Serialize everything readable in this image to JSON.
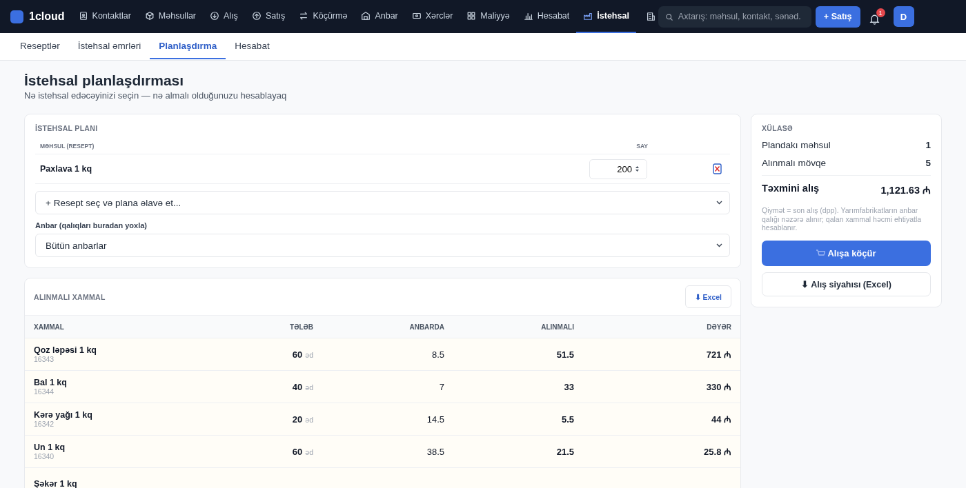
{
  "topbar": {
    "logo": "1cloud",
    "nav": [
      {
        "label": "Kontaktlar",
        "selected": false
      },
      {
        "label": "Məhsullar",
        "selected": false
      },
      {
        "label": "Alış",
        "selected": false
      },
      {
        "label": "Satış",
        "selected": false
      },
      {
        "label": "Köçürmə",
        "selected": false
      },
      {
        "label": "Anbar",
        "selected": false
      },
      {
        "label": "Xərclər",
        "selected": false
      },
      {
        "label": "Maliyyə",
        "selected": false
      },
      {
        "label": "Hesabat",
        "selected": false
      },
      {
        "label": "İstehsal",
        "selected": true
      }
    ],
    "search": {
      "placeholder": "Axtarış: məhsul, kontakt, sənəd."
    },
    "new_sale_button": "+ Satış",
    "notifications": "1",
    "avatar": "D"
  },
  "subtabs": [
    {
      "label": "Reseptlər",
      "selected": false
    },
    {
      "label": "İstehsal əmrləri",
      "selected": false
    },
    {
      "label": "Planlaşdırma",
      "selected": true
    },
    {
      "label": "Hesabat",
      "selected": false
    }
  ],
  "page": {
    "title": "İstehsal planlaşdırması",
    "subtitle": "Nə istehsal edəcəyinizi seçin — nə almalı olduğunuzu hesablayaq"
  },
  "plan": {
    "title": "İSTEHSAL PLANI",
    "columns": [
      "MƏHSUL (RESEPT)",
      "SAY"
    ],
    "rows": [
      {
        "product": "Paxlava 1 kq",
        "quantity": "200"
      }
    ],
    "add_select": "+ Resept seç və plana əlavə et...",
    "warehouse_label": "Anbar (qalıqları buradan yoxla)",
    "warehouse_select": "Bütün anbarlar"
  },
  "summary": {
    "title": "XÜLASƏ",
    "rows": [
      {
        "label": "Plandakı məhsul",
        "value": "1"
      },
      {
        "label": "Alınmalı mövqe",
        "value": "5"
      }
    ],
    "total_label": "Təxmini alış",
    "total_value": "1,121.63 ₼",
    "note": "Qiymət = son alış (dpp). Yarımfabrikatların anbar qalığı nəzərə alınır; qalan xammal həcmi ehtiyatla hesablanır.",
    "primary_button": "Alışa köçür",
    "excel_button": "⬇ Alış siyahısı (Excel)"
  },
  "materials": {
    "title": "ALINMALI XAMMAL",
    "excel_button": "⬇ Excel",
    "columns": [
      "XAMMAL",
      "TƏLƏB",
      "ANBARDA",
      "ALINMALI",
      "DƏYƏR"
    ],
    "rows": [
      {
        "name": "Qoz ləpəsi 1 kq",
        "code": "16343",
        "need": "60",
        "unit": "əd",
        "stock": "8.5",
        "to_buy": "51.5",
        "value": "721 ₼"
      },
      {
        "name": "Bal 1 kq",
        "code": "16344",
        "need": "40",
        "unit": "əd",
        "stock": "7",
        "to_buy": "33",
        "value": "330 ₼"
      },
      {
        "name": "Kərə yağı 1 kq",
        "code": "16342",
        "need": "20",
        "unit": "əd",
        "stock": "14.5",
        "to_buy": "5.5",
        "value": "44 ₼"
      },
      {
        "name": "Un 1 kq",
        "code": "16340",
        "need": "60",
        "unit": "əd",
        "stock": "38.5",
        "to_buy": "21.5",
        "value": "25.8 ₼"
      },
      {
        "name": "Şəkər 1 kq",
        "code": "",
        "need": "",
        "unit": "",
        "stock": "",
        "to_buy": "",
        "value": ""
      }
    ]
  }
}
